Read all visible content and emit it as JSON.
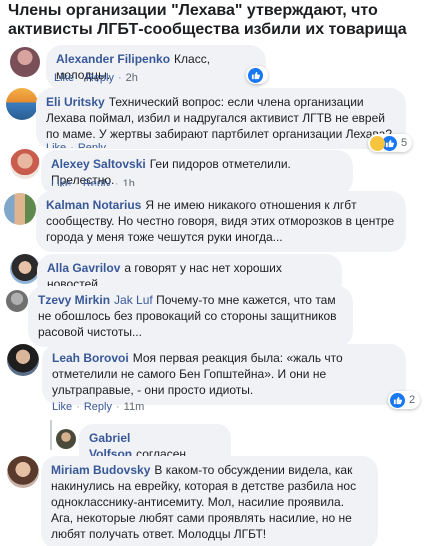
{
  "headline": "Члены организации \"Лехава\" утверждают, что активисты ЛГБТ-сообщества избили их товарища",
  "actions": {
    "like": "Like",
    "reply": "Reply"
  },
  "comments": [
    {
      "author": "Alexander Filipenko",
      "text": "Класс, молодцы.",
      "time": "2h",
      "reactions": "",
      "reaction_types": [
        "like"
      ]
    },
    {
      "author": "Eli Uritsky",
      "text": "Технический вопрос: если члена организации Лехава поймал, избил и надругался активист ЛГТВ не еврей по маме. У жертвы забирают партбилет организации Лехава?",
      "time": "",
      "reactions": "5",
      "reaction_types": [
        "haha",
        "like"
      ]
    },
    {
      "author": "Alexey Saltovski",
      "text": "Геи пидоров отметелили. Прелестно.",
      "time": "1h",
      "reactions": "",
      "reaction_types": [
        "like"
      ]
    },
    {
      "author": "Kalman Notarius",
      "text": "Я не имею никакого отношения к лгбт сообществу. Но честно говоря, видя этих отморозков в центре города у меня тоже чешутся руки иногда...",
      "time": "",
      "reactions": "",
      "reaction_types": []
    },
    {
      "author": "Alla Gavrilov",
      "text": "а говорят у нас нет хороших новостей...",
      "time": "",
      "reactions": "",
      "reaction_types": []
    },
    {
      "author": "Tzevy Mirkin",
      "mention": "Jak Luf",
      "text": "Почему-то мне кажется, что там не обошлось без провокаций со стороны защитников расовой чистоты...",
      "time": "",
      "reactions": "",
      "reaction_types": []
    },
    {
      "author": "Leah Borovoi",
      "text": "Моя первая реакция была: «жаль что отметелили не самого Бен Гопштейна». И они не ультраправые, - они просто идиоты.",
      "time": "11m",
      "reactions": "2",
      "reaction_types": [
        "like"
      ]
    },
    {
      "author": "Gabriel Volfson",
      "text": "согласен",
      "time": "",
      "reactions": "",
      "reaction_types": []
    },
    {
      "author": "Miriam Budovsky",
      "text": "В каком-то обсуждении видела, как накинулись на еврейку, которая в детстве разбила нос однокласснику-антисемиту. Мол, насилие проявила. Ага, некоторые любят сами проявлять насилие, но не любят получать ответ. Молодцы ЛГБТ!",
      "time": "",
      "reactions": "",
      "reaction_types": []
    }
  ],
  "colors": {
    "link": "#385898",
    "bubble": "#f0f2f5",
    "like": "#1877f2",
    "haha": "#f7c43e"
  }
}
